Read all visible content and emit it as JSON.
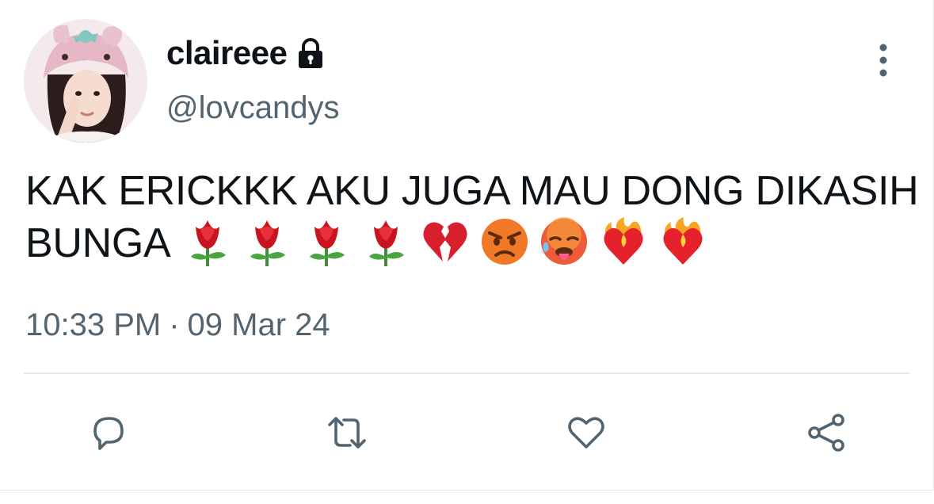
{
  "user": {
    "display_name": "claireee",
    "handle": "@lovcandys",
    "lock_icon": "lock-icon",
    "avatar": "user-avatar"
  },
  "menu_icon": "more-vertical-icon",
  "tweet": {
    "text": "KAK ERICKKK AKU JUGA MAU DONG DIKASIH BUNGA",
    "emojis": [
      "rose",
      "rose",
      "rose",
      "rose",
      "broken-heart",
      "angry-face",
      "hot-face",
      "heart-on-fire",
      "heart-on-fire"
    ]
  },
  "meta": {
    "time": "10:33 PM",
    "separator": "·",
    "date": "09 Mar 24"
  },
  "actions": [
    {
      "name": "reply",
      "icon": "reply-icon"
    },
    {
      "name": "retweet",
      "icon": "retweet-icon"
    },
    {
      "name": "like",
      "icon": "heart-icon"
    },
    {
      "name": "share",
      "icon": "share-icon"
    }
  ],
  "colors": {
    "text": "#0f1419",
    "secondary": "#536471",
    "divider": "#e6e9ec"
  }
}
